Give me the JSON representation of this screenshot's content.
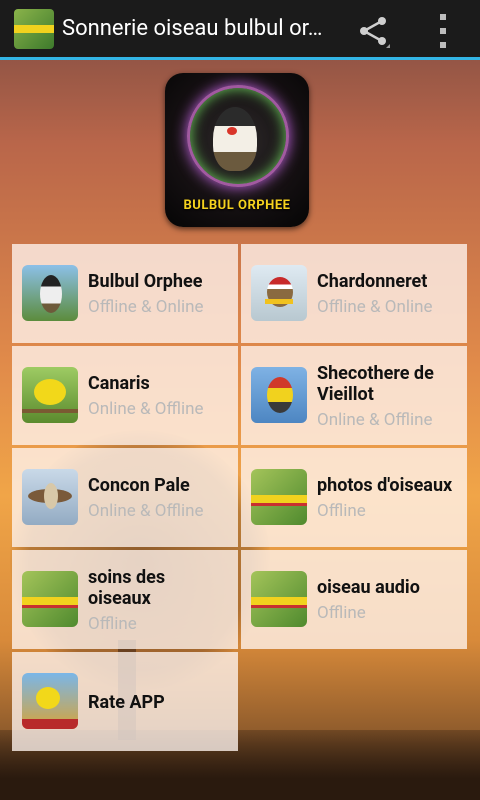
{
  "actionbar": {
    "title": "Sonnerie oiseau bulbul or…",
    "icons": [
      "app-icon",
      "share-icon",
      "overflow-menu-icon"
    ]
  },
  "header": {
    "logo_caption": "BULBUL ORPHEE"
  },
  "items": [
    {
      "name": "Bulbul Orphee",
      "sub": "Offline & Online",
      "icon": "bulbul-thumb"
    },
    {
      "name": "Chardonneret",
      "sub": "Offline & Online",
      "icon": "goldfinch-thumb"
    },
    {
      "name": "Canaris",
      "sub": "Online & Offline",
      "icon": "canary-thumb"
    },
    {
      "name": "Shecothere de Vieillot",
      "sub": "Online & Offline",
      "icon": "barbet-thumb"
    },
    {
      "name": "Concon Pale",
      "sub": "Online & Offline",
      "icon": "hawk-thumb"
    },
    {
      "name": "photos d'oiseaux",
      "sub": "Offline",
      "icon": "app-thumb"
    },
    {
      "name": "soins des oiseaux",
      "sub": "Offline",
      "icon": "app-thumb"
    },
    {
      "name": "oiseau audio",
      "sub": "Offline",
      "icon": "app-thumb"
    },
    {
      "name": "Rate APP",
      "sub": "",
      "icon": "rate-thumb"
    }
  ]
}
